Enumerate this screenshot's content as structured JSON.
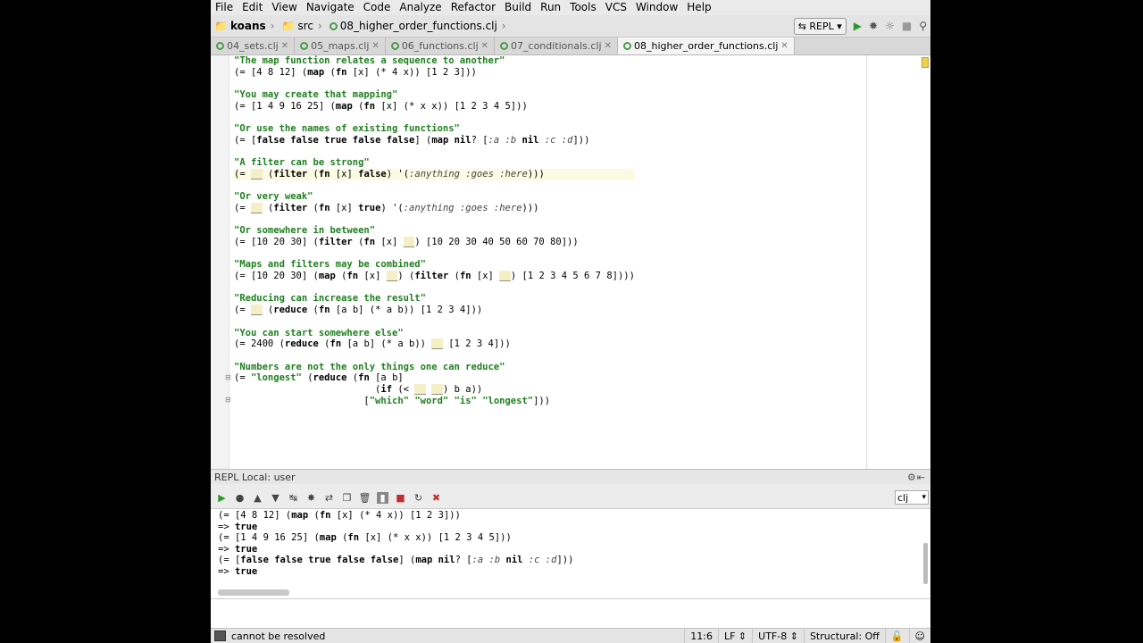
{
  "menu": [
    "File",
    "Edit",
    "View",
    "Navigate",
    "Code",
    "Analyze",
    "Refactor",
    "Build",
    "Run",
    "Tools",
    "VCS",
    "Window",
    "Help"
  ],
  "breadcrumb": {
    "project": "koans",
    "folder": "src",
    "file": "08_higher_order_functions.clj"
  },
  "toolbar": {
    "repl_label": "REPL"
  },
  "tabs": [
    {
      "label": "04_sets.clj",
      "active": false
    },
    {
      "label": "05_maps.clj",
      "active": false
    },
    {
      "label": "06_functions.clj",
      "active": false
    },
    {
      "label": "07_conditionals.clj",
      "active": false
    },
    {
      "label": "08_higher_order_functions.clj",
      "active": true
    }
  ],
  "code_lines": [
    "\"The map function relates a sequence to another\"",
    "(= [4 8 12] (map (fn [x] (* 4 x)) [1 2 3]))",
    "",
    "\"You may create that mapping\"",
    "(= [1 4 9 16 25] (map (fn [x] (* x x)) [1 2 3 4 5]))",
    "",
    "\"Or use the names of existing functions\"",
    "(= [false false true false false] (map nil? [:a :b nil :c :d]))",
    "",
    "\"A filter can be strong\"",
    "(= __ (filter (fn [x] false) '(:anything :goes :here)))",
    "",
    "\"Or very weak\"",
    "(= __ (filter (fn [x] true) '(:anything :goes :here)))",
    "",
    "\"Or somewhere in between\"",
    "(= [10 20 30] (filter (fn [x] __) [10 20 30 40 50 60 70 80]))",
    "",
    "\"Maps and filters may be combined\"",
    "(= [10 20 30] (map (fn [x] __) (filter (fn [x] __) [1 2 3 4 5 6 7 8])))",
    "",
    "\"Reducing can increase the result\"",
    "(= __ (reduce (fn [a b] (* a b)) [1 2 3 4]))",
    "",
    "\"You can start somewhere else\"",
    "(= 2400 (reduce (fn [a b] (* a b)) __ [1 2 3 4]))",
    "",
    "\"Numbers are not the only things one can reduce\"",
    "(= \"longest\" (reduce (fn [a b]",
    "                         (if (< __ __) b a))",
    "                       [\"which\" \"word\" \"is\" \"longest\"]))"
  ],
  "repl": {
    "panel_title": "REPL Local: user",
    "language": "clj",
    "output": [
      "(= [4 8 12] (map (fn [x] (* 4 x)) [1 2 3]))",
      "=> true",
      "(= [1 4 9 16 25] (map (fn [x] (* x x)) [1 2 3 4 5]))",
      "=> true",
      "(= [false false true false false] (map nil? [:a :b nil :c :d]))",
      "=> true"
    ]
  },
  "status": {
    "message": "cannot be resolved",
    "position": "11:6",
    "line_sep": "LF",
    "encoding": "UTF-8",
    "mode": "Structural: Off"
  }
}
